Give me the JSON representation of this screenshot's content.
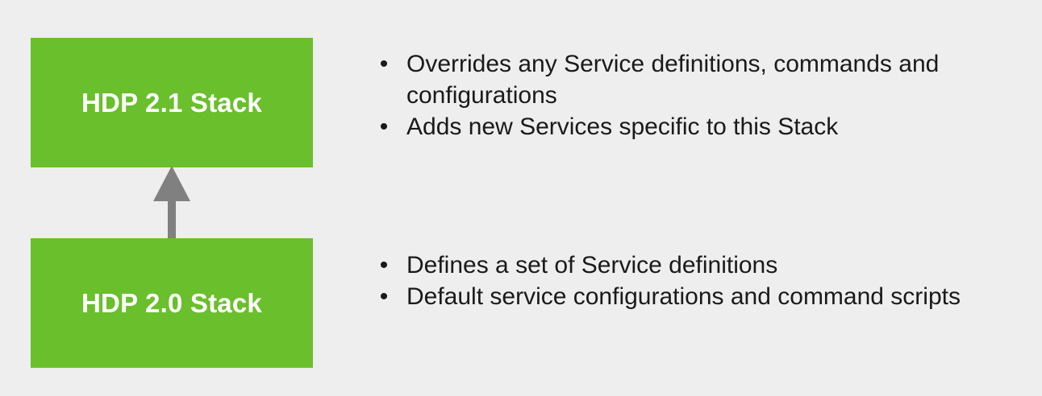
{
  "diagram": {
    "stacks": [
      {
        "label": "HDP 2.1 Stack",
        "bullets": [
          "Overrides any Service definitions, commands and configurations",
          "Adds new Services specific to this Stack"
        ]
      },
      {
        "label": "HDP 2.0 Stack",
        "bullets": [
          "Defines a set of Service definitions",
          "Default service configurations and command scripts"
        ]
      }
    ],
    "colors": {
      "box_fill": "#6abf2c",
      "box_text": "#ffffff",
      "arrow": "#808080",
      "background": "#eeeeee",
      "text": "#1a1a1a"
    },
    "bullet_glyph": "•"
  }
}
